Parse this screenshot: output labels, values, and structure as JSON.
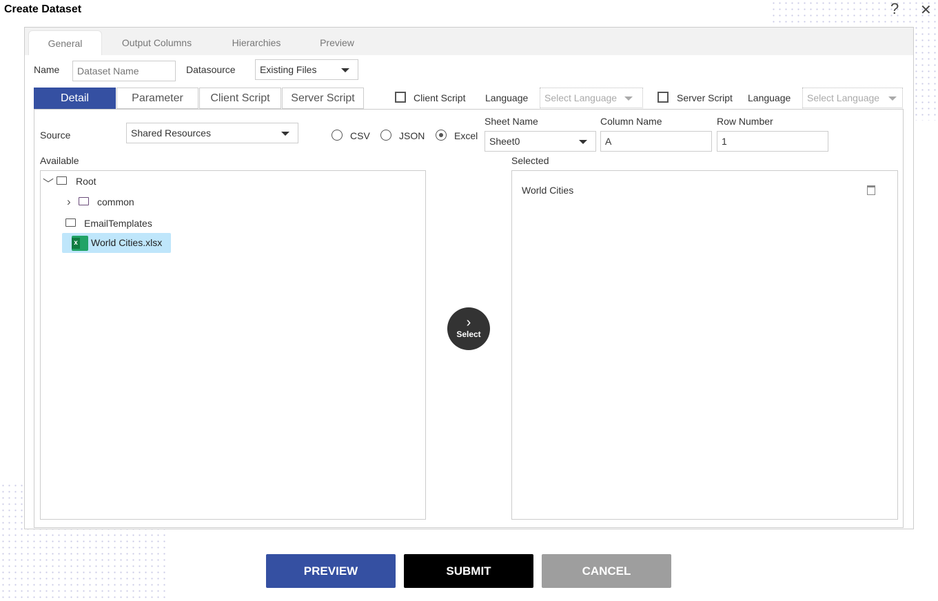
{
  "dialog": {
    "title": "Create Dataset",
    "help": "?",
    "close": "✕"
  },
  "tabs": [
    {
      "label": "General",
      "active": true
    },
    {
      "label": "Output Columns"
    },
    {
      "label": "Hierarchies"
    },
    {
      "label": "Preview"
    }
  ],
  "name": {
    "label": "Name",
    "placeholder": "Dataset Name",
    "value": ""
  },
  "datasource": {
    "label": "Datasource",
    "value": "Existing Files"
  },
  "subtabs": [
    {
      "label": "Detail",
      "active": true
    },
    {
      "label": "Parameter"
    },
    {
      "label": "Client Script"
    },
    {
      "label": "Server Script"
    }
  ],
  "client_script": {
    "label": "Client Script",
    "checked": false,
    "language_label": "Language",
    "language_placeholder": "Select Language"
  },
  "server_script": {
    "label": "Server Script",
    "checked": false,
    "language_label": "Language",
    "language_placeholder": "Select Language"
  },
  "source": {
    "label": "Source",
    "value": "Shared Resources"
  },
  "formats": [
    {
      "label": "CSV",
      "selected": false
    },
    {
      "label": "JSON",
      "selected": false
    },
    {
      "label": "Excel",
      "selected": true
    }
  ],
  "sheet": {
    "label": "Sheet Name",
    "value": "Sheet0"
  },
  "column": {
    "label": "Column Name",
    "value": "A"
  },
  "row": {
    "label": "Row Number",
    "value": "1"
  },
  "available": {
    "label": "Available",
    "tree": [
      {
        "label": "Root",
        "icon": "folder-icon"
      },
      {
        "label": "common",
        "icon": "folder-icon"
      },
      {
        "label": "EmailTemplates",
        "icon": "folder-icon"
      },
      {
        "label": "World Cities.xlsx",
        "icon": "excel-icon",
        "selected": true
      }
    ]
  },
  "select_button": {
    "label": "Select"
  },
  "selected": {
    "label": "Selected",
    "items": [
      "World Cities"
    ]
  },
  "footer": {
    "preview": "PREVIEW",
    "submit": "SUBMIT",
    "cancel": "CANCEL"
  },
  "colors": {
    "primary": "#3550a2",
    "submit": "#000000",
    "cancel": "#9e9e9e",
    "selection": "#bfe6fb"
  }
}
